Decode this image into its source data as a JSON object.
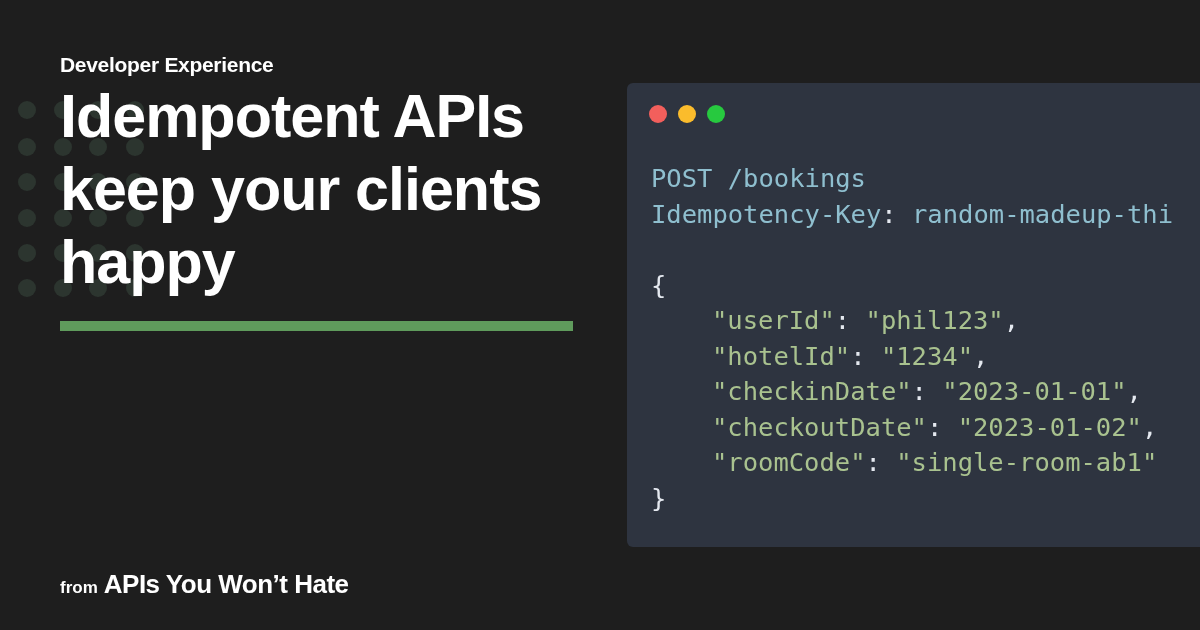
{
  "category": "Developer Experience",
  "title_lines": [
    "Idempotent APIs",
    "keep your clients",
    "happy"
  ],
  "code_window": {
    "request_lines": [
      {
        "segments": [
          {
            "kind": "request",
            "text": "POST /bookings"
          }
        ]
      },
      {
        "segments": [
          {
            "kind": "request",
            "text": "Idempotency-Key"
          },
          {
            "kind": "punct",
            "text": ": "
          },
          {
            "kind": "request",
            "text": "random-madeup-thi"
          }
        ]
      }
    ],
    "body_lines": [
      {
        "indented": false,
        "segments": [
          {
            "kind": "punct",
            "text": "{"
          }
        ]
      },
      {
        "indented": true,
        "segments": [
          {
            "kind": "string",
            "text": "\"userId\""
          },
          {
            "kind": "punct",
            "text": ": "
          },
          {
            "kind": "string",
            "text": "\"phil123\""
          },
          {
            "kind": "punct",
            "text": ","
          }
        ]
      },
      {
        "indented": true,
        "segments": [
          {
            "kind": "string",
            "text": "\"hotelId\""
          },
          {
            "kind": "punct",
            "text": ": "
          },
          {
            "kind": "string",
            "text": "\"1234\""
          },
          {
            "kind": "punct",
            "text": ","
          }
        ]
      },
      {
        "indented": true,
        "segments": [
          {
            "kind": "string",
            "text": "\"checkinDate\""
          },
          {
            "kind": "punct",
            "text": ": "
          },
          {
            "kind": "string",
            "text": "\"2023-01-01\""
          },
          {
            "kind": "punct",
            "text": ","
          }
        ]
      },
      {
        "indented": true,
        "segments": [
          {
            "kind": "string",
            "text": "\"checkoutDate\""
          },
          {
            "kind": "punct",
            "text": ": "
          },
          {
            "kind": "string",
            "text": "\"2023-01-02\""
          },
          {
            "kind": "punct",
            "text": ","
          }
        ]
      },
      {
        "indented": true,
        "segments": [
          {
            "kind": "string",
            "text": "\"roomCode\""
          },
          {
            "kind": "punct",
            "text": ": "
          },
          {
            "kind": "string",
            "text": "\"single-room-ab1\""
          }
        ]
      },
      {
        "indented": false,
        "segments": [
          {
            "kind": "punct",
            "text": "}"
          }
        ]
      }
    ]
  },
  "footer": {
    "prefix": "from",
    "site": "APIs You Won’t Hate"
  }
}
